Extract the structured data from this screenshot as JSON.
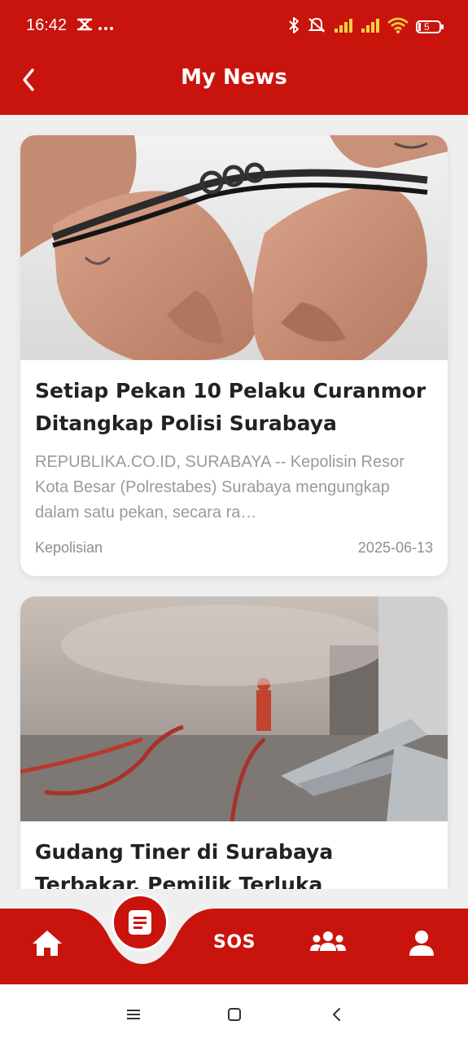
{
  "status_bar": {
    "time": "16:42",
    "battery": "5"
  },
  "header": {
    "title": "My News"
  },
  "articles": [
    {
      "title": "Setiap Pekan 10 Pelaku Curanmor Ditangkap Polisi Surabaya",
      "excerpt": "REPUBLIKA.CO.ID, SURABAYA -- Kepolisin Resor Kota Besar (Polrestabes) Surabaya mengungkap dalam satu pekan, secara ra…",
      "category": "Kepolisian",
      "date": "2025-06-13",
      "image": "handcuffed-hands-photo"
    },
    {
      "title": "Gudang Tiner di Surabaya Terbakar, Pemilik Terluka",
      "image": "warehouse-fire-photo"
    }
  ],
  "bottom_nav": {
    "items": [
      {
        "icon": "home-icon"
      },
      {
        "icon": "news-icon",
        "active": true
      },
      {
        "label": "SOS"
      },
      {
        "icon": "community-icon"
      },
      {
        "icon": "profile-icon"
      }
    ]
  },
  "colors": {
    "primary": "#c9140d",
    "background": "#efefef",
    "card": "#ffffff",
    "title_text": "#222222",
    "muted_text": "#9a9a9a"
  }
}
